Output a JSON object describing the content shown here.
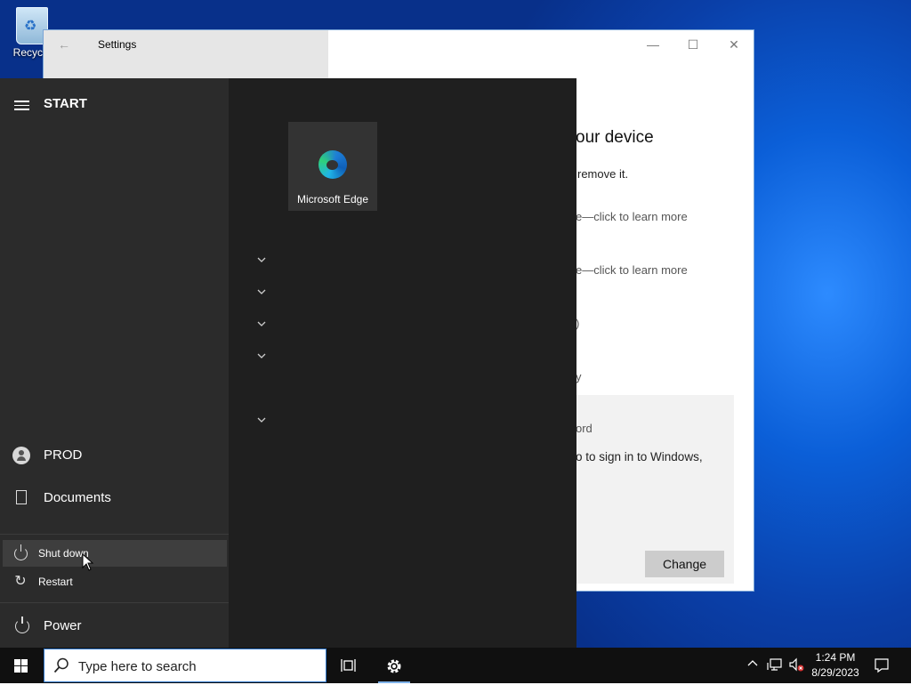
{
  "desktop": {
    "recycle_bin_label": "Recycle"
  },
  "settings_window": {
    "title": "Settings",
    "back_icon": "arrow-left-icon",
    "controls": [
      "—",
      "☐",
      "✕"
    ],
    "heading_partial": "our device",
    "line1_partial": "remove it.",
    "link1_partial": "e—click to learn more",
    "link2_partial": "e—click to learn more",
    "fragment1": ")",
    "fragment2": "y",
    "panel_title_partial": "ord",
    "panel_text_partial": "o to sign in to Windows,",
    "change_button": "Change"
  },
  "start_menu": {
    "label": "START",
    "user": "PROD",
    "documents": "Documents",
    "power": "Power",
    "power_menu": [
      {
        "label": "Shut down",
        "icon": "power-icon"
      },
      {
        "label": "Restart",
        "icon": "restart-icon"
      }
    ],
    "tile": {
      "label": "Microsoft Edge",
      "icon": "edge-icon"
    },
    "group_chevrons": 5
  },
  "taskbar": {
    "search_placeholder": "Type here to search",
    "time": "1:24 PM",
    "date": "8/29/2023",
    "tray_icons": [
      "chevron-up-icon",
      "network-icon",
      "volume-muted-icon",
      "notifications-icon"
    ]
  },
  "colors": {
    "accent": "#2e75c8",
    "start_bg": "#1f1f1f",
    "start_left_bg": "#2b2b2b",
    "taskbar_bg": "#101010"
  }
}
